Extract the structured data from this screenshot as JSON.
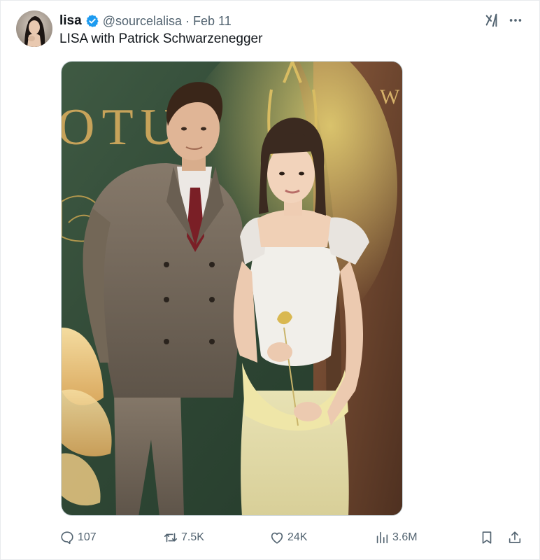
{
  "author": {
    "display_name": "lisa",
    "handle": "@sourcelalisa",
    "separator": "·",
    "date": "Feb 11",
    "verified": true,
    "verified_color": "#1d9bf0"
  },
  "tweet": {
    "text": "LISA with Patrick Schwarzenegger"
  },
  "media": {
    "backdrop_text_left": "OTU",
    "backdrop_text_right": "W"
  },
  "icons": {
    "grok": "grok-icon",
    "more": "more-dots-icon",
    "reply": "reply-icon",
    "repost": "repost-icon",
    "like": "heart-icon",
    "views": "views-chart-icon",
    "bookmark": "bookmark-icon",
    "share": "share-icon"
  },
  "actions": {
    "reply_count": "107",
    "repost_count": "7.5K",
    "like_count": "24K",
    "views_count": "3.6M"
  },
  "colors": {
    "text_primary": "#0f1419",
    "text_secondary": "#536471",
    "accent": "#1d9bf0"
  }
}
